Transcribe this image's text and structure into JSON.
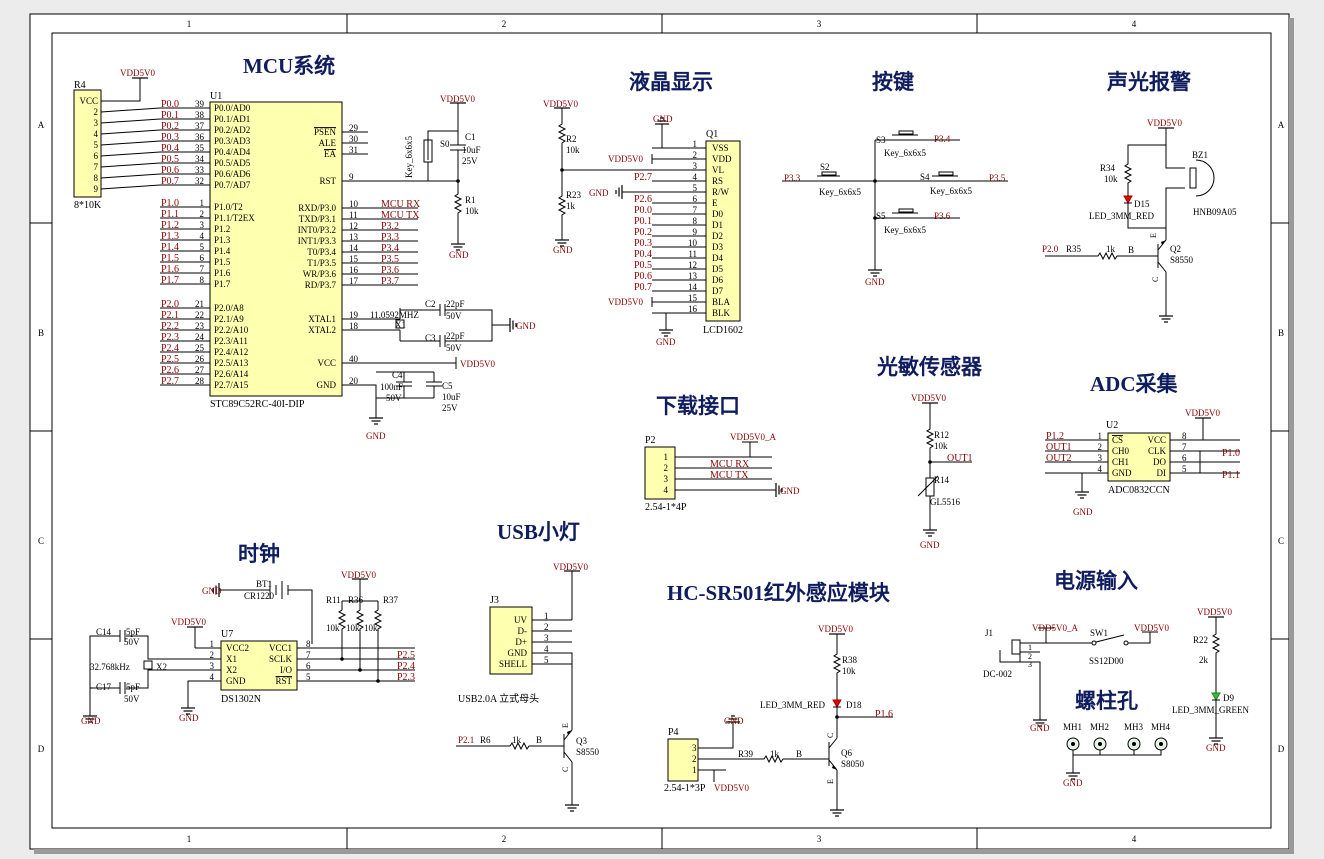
{
  "frame": {
    "cols": [
      "1",
      "2",
      "3",
      "4"
    ],
    "rows": [
      "A",
      "B",
      "C",
      "D"
    ]
  },
  "titles": {
    "mcu": "MCU系统",
    "lcd": "液晶显示",
    "keys": "按键",
    "alarm": "声光报警",
    "download": "下载接口",
    "light": "光敏传感器",
    "adc": "ADC采集",
    "clock": "时钟",
    "usb": "USB小灯",
    "pir": "HC-SR501红外感应模块",
    "power": "电源输入",
    "holes": "螺柱孔"
  },
  "net": {
    "vdd": "VDD5V0",
    "vdd_a": "VDD5V0_A",
    "gnd": "GND",
    "mcu_rx": "MCU RX",
    "mcu_tx": "MCU TX",
    "out1": "OUT1",
    "out2": "OUT2"
  },
  "r4": {
    "ref": "R4",
    "value": "8*10K",
    "pins": [
      "VCC",
      "2",
      "3",
      "4",
      "5",
      "6",
      "7",
      "8",
      "9"
    ],
    "nets": [
      "P0.0",
      "P0.1",
      "P0.2",
      "P0.3",
      "P0.4",
      "P0.5",
      "P0.6",
      "P0.7"
    ]
  },
  "u1": {
    "ref": "U1",
    "part": "STC89C52RC-40I-DIP",
    "left": [
      {
        "net": "P0.0",
        "num": "39",
        "label": "P0.0/AD0"
      },
      {
        "net": "P0.1",
        "num": "38",
        "label": "P0.1/AD1"
      },
      {
        "net": "P0.2",
        "num": "37",
        "label": "P0.2/AD2"
      },
      {
        "net": "P0.3",
        "num": "36",
        "label": "P0.3/AD3"
      },
      {
        "net": "P0.4",
        "num": "35",
        "label": "P0.4/AD4"
      },
      {
        "net": "P0.5",
        "num": "34",
        "label": "P0.5/AD5"
      },
      {
        "net": "P0.6",
        "num": "33",
        "label": "P0.6/AD6"
      },
      {
        "net": "P0.7",
        "num": "32",
        "label": "P0.7/AD7"
      },
      {
        "net": "P1.0",
        "num": "1",
        "label": "P1.0/T2"
      },
      {
        "net": "P1.1",
        "num": "2",
        "label": "P1.1/T2EX"
      },
      {
        "net": "P1.2",
        "num": "3",
        "label": "P1.2"
      },
      {
        "net": "P1.3",
        "num": "4",
        "label": "P1.3"
      },
      {
        "net": "P1.4",
        "num": "5",
        "label": "P1.4"
      },
      {
        "net": "P1.5",
        "num": "6",
        "label": "P1.5"
      },
      {
        "net": "P1.6",
        "num": "7",
        "label": "P1.6"
      },
      {
        "net": "P1.7",
        "num": "8",
        "label": "P1.7"
      },
      {
        "net": "P2.0",
        "num": "21",
        "label": "P2.0/A8"
      },
      {
        "net": "P2.1",
        "num": "22",
        "label": "P2.1/A9"
      },
      {
        "net": "P2.2",
        "num": "23",
        "label": "P2.2/A10"
      },
      {
        "net": "P2.3",
        "num": "24",
        "label": "P2.3/A11"
      },
      {
        "net": "P2.4",
        "num": "25",
        "label": "P2.4/A12"
      },
      {
        "net": "P2.5",
        "num": "26",
        "label": "P2.5/A13"
      },
      {
        "net": "P2.6",
        "num": "27",
        "label": "P2.6/A14"
      },
      {
        "net": "P2.7",
        "num": "28",
        "label": "P2.7/A15"
      }
    ],
    "right": [
      {
        "label": "PSEN",
        "num": "29",
        "net": ""
      },
      {
        "label": "ALE",
        "num": "30",
        "net": ""
      },
      {
        "label": "EA",
        "num": "31",
        "net": ""
      },
      {
        "label": "RST",
        "num": "9",
        "net": ""
      },
      {
        "label": "RXD/P3.0",
        "num": "10",
        "net": "MCU RX"
      },
      {
        "label": "TXD/P3.1",
        "num": "11",
        "net": "MCU TX"
      },
      {
        "label": "INT0/P3.2",
        "num": "12",
        "net": "P3.2"
      },
      {
        "label": "INT1/P3.3",
        "num": "13",
        "net": "P3.3"
      },
      {
        "label": "T0/P3.4",
        "num": "14",
        "net": "P3.4"
      },
      {
        "label": "T1/P3.5",
        "num": "15",
        "net": "P3.5"
      },
      {
        "label": "WR/P3.6",
        "num": "16",
        "net": "P3.6"
      },
      {
        "label": "RD/P3.7",
        "num": "17",
        "net": "P3.7"
      },
      {
        "label": "XTAL1",
        "num": "19",
        "net": ""
      },
      {
        "label": "XTAL2",
        "num": "18",
        "net": ""
      },
      {
        "label": "VCC",
        "num": "40",
        "net": "VDD5V0"
      },
      {
        "label": "GND",
        "num": "20",
        "net": ""
      }
    ]
  },
  "reset": {
    "s0": "S0",
    "s0_part": "Key_6x6x5",
    "c1": "C1",
    "c1_val": "10uF",
    "c1_v": "25V",
    "r1": "R1",
    "r1_val": "10k"
  },
  "crystal": {
    "x1": "X1",
    "freq": "11.0592MHZ",
    "c2": "C2",
    "c3": "C3",
    "cval": "22pF",
    "cv": "50V"
  },
  "decoupling": {
    "c4": "C4",
    "c4_val": "100nF",
    "c4_v": "50V",
    "c5": "C5",
    "c5_val": "10uF",
    "c5_v": "25V"
  },
  "lcd": {
    "ref": "Q1",
    "part": "LCD1602",
    "pins": [
      {
        "num": "1",
        "label": "VSS",
        "net": ""
      },
      {
        "num": "2",
        "label": "VDD",
        "net": "VDD5V0"
      },
      {
        "num": "3",
        "label": "VL",
        "net": ""
      },
      {
        "num": "4",
        "label": "RS",
        "net": "P2.7"
      },
      {
        "num": "5",
        "label": "R/W",
        "net": ""
      },
      {
        "num": "6",
        "label": "E",
        "net": "P2.6"
      },
      {
        "num": "7",
        "label": "D0",
        "net": "P0.0"
      },
      {
        "num": "8",
        "label": "D1",
        "net": "P0.1"
      },
      {
        "num": "9",
        "label": "D2",
        "net": "P0.2"
      },
      {
        "num": "10",
        "label": "D3",
        "net": "P0.3"
      },
      {
        "num": "11",
        "label": "D4",
        "net": "P0.4"
      },
      {
        "num": "12",
        "label": "D5",
        "net": "P0.5"
      },
      {
        "num": "13",
        "label": "D6",
        "net": "P0.6"
      },
      {
        "num": "14",
        "label": "D7",
        "net": "P0.7"
      },
      {
        "num": "15",
        "label": "BLA",
        "net": "VDD5V0"
      },
      {
        "num": "16",
        "label": "BLK",
        "net": ""
      }
    ],
    "r2": "R2",
    "r2_val": "10k",
    "r23": "R23",
    "r23_val": "1k"
  },
  "keys": {
    "s2": "S2",
    "s3": "S3",
    "s4": "S4",
    "s5": "S5",
    "part": "Key_6x6x5",
    "p33": "P3.3",
    "p34": "P3.4",
    "p35": "P3.5",
    "p36": "P3.6"
  },
  "alarm": {
    "r34": "R34",
    "r34_val": "10k",
    "d15": "D15",
    "led": "LED_3MM_RED",
    "bz1": "BZ1",
    "bz_part": "HNB09A05",
    "q2": "Q2",
    "q2_part": "S8550",
    "r35": "R35",
    "r35_val": "1k",
    "net": "P2.0",
    "b": "B",
    "c": "C",
    "e": "E"
  },
  "download": {
    "ref": "P2",
    "part": "2.54-1*4P",
    "pins": [
      "1",
      "2",
      "3",
      "4"
    ]
  },
  "light": {
    "r12": "R12",
    "r12_val": "10k",
    "r14": "R14",
    "r14_part": "GL5516"
  },
  "adc": {
    "ref": "U2",
    "part": "ADC0832CCN",
    "left": [
      {
        "net": "P1.2",
        "num": "1",
        "label": "CS"
      },
      {
        "net": "OUT1",
        "num": "2",
        "label": "CH0"
      },
      {
        "net": "OUT2",
        "num": "3",
        "label": "CH1"
      },
      {
        "net": "",
        "num": "4",
        "label": "GND"
      }
    ],
    "right": [
      {
        "label": "VCC",
        "num": "8",
        "net": ""
      },
      {
        "label": "CLK",
        "num": "7",
        "net": "P1.0"
      },
      {
        "label": "DO",
        "num": "6",
        "net": ""
      },
      {
        "label": "DI",
        "num": "5",
        "net": "P1.1"
      }
    ]
  },
  "clock": {
    "bt1": "BT1",
    "bt_part": "CR1220",
    "c14": "C14",
    "c17": "C17",
    "cval": "5pF",
    "cv": "50V",
    "x2": "X2",
    "xfreq": "32.768kHz",
    "u7": "U7",
    "u7_part": "DS1302N",
    "u7_left": [
      {
        "num": "1",
        "label": "VCC2"
      },
      {
        "num": "2",
        "label": "X1"
      },
      {
        "num": "3",
        "label": "X2"
      },
      {
        "num": "4",
        "label": "GND"
      }
    ],
    "u7_right": [
      {
        "num": "8",
        "label": "VCC1",
        "net": ""
      },
      {
        "num": "7",
        "label": "SCLK",
        "net": "P2.5"
      },
      {
        "num": "6",
        "label": "I/O",
        "net": "P2.4"
      },
      {
        "num": "5",
        "label": "RST",
        "net": "P2.3"
      }
    ],
    "r11": "R11",
    "r36": "R36",
    "r37": "R37",
    "rval": "10k"
  },
  "usb": {
    "ref": "J3",
    "part": "USB2.0A 立式母头",
    "pins": [
      {
        "num": "1",
        "label": "UV"
      },
      {
        "num": "2",
        "label": "D-"
      },
      {
        "num": "3",
        "label": "D+"
      },
      {
        "num": "4",
        "label": "GND"
      },
      {
        "num": "5",
        "label": "SHELL"
      }
    ],
    "q3": "Q3",
    "q3_part": "S8550",
    "r6": "R6",
    "r6_val": "1k",
    "net": "P2.1"
  },
  "pir": {
    "r38": "R38",
    "r38_val": "10k",
    "d18": "D18",
    "led": "LED_3MM_RED",
    "net": "P1.6",
    "ref": "P4",
    "part": "2.54-1*3P",
    "pins": [
      "3",
      "2",
      "1"
    ],
    "r39": "R39",
    "r39_val": "1k",
    "q6": "Q6",
    "q6_part": "S8050"
  },
  "power": {
    "j1": "J1",
    "j1_part": "DC-002",
    "sw1": "SW1",
    "sw_part": "SS12D00",
    "r22": "R22",
    "r22_val": "2k",
    "d9": "D9",
    "led": "LED_3MM_GREEN"
  },
  "holes": [
    "MH1",
    "MH2",
    "MH3",
    "MH4"
  ]
}
